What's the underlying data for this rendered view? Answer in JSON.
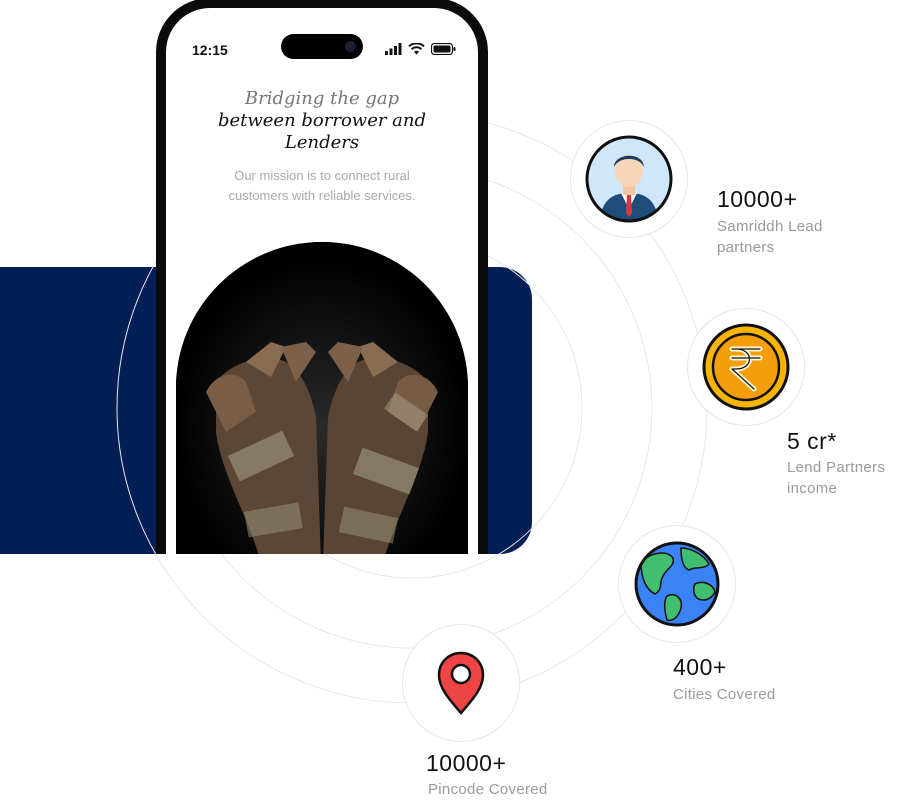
{
  "phone": {
    "time": "12:15",
    "headline_line1": "Bridging the gap",
    "headline_line2": "between borrower and",
    "headline_line3": "Lenders",
    "mission_line1": "Our mission is to connect rural",
    "mission_line2": "customers with reliable services."
  },
  "stats": [
    {
      "icon": "business-person-icon",
      "value": "10000+",
      "label_line1": "Samriddh Lead",
      "label_line2": "partners"
    },
    {
      "icon": "rupee-coin-icon",
      "value": "5 cr*",
      "label_line1": "Lend Partners",
      "label_line2": "income"
    },
    {
      "icon": "globe-icon",
      "value": "400+",
      "label_line1": "Cities Covered",
      "label_line2": ""
    },
    {
      "icon": "location-pin-icon",
      "value": "10000+",
      "label_line1": "Pincode Covered",
      "label_line2": ""
    }
  ],
  "colors": {
    "navy": "#031f55",
    "label_gray": "#9a9a9a",
    "coin_gold": "#f7b500",
    "pin_red": "#ef4444"
  }
}
